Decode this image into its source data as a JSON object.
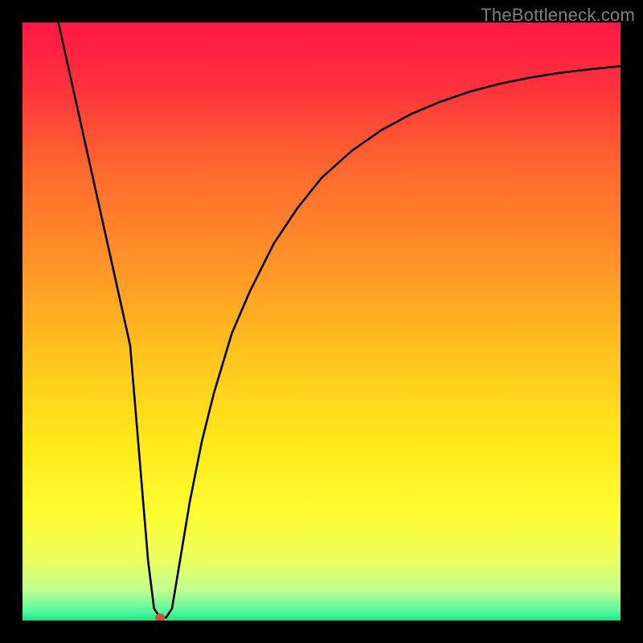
{
  "watermark": "TheBottleneck.com",
  "chart_data": {
    "type": "line",
    "title": "",
    "xlabel": "",
    "ylabel": "",
    "xlim": [
      0,
      100
    ],
    "ylim": [
      0,
      100
    ],
    "grid": false,
    "legend": false,
    "gradient_stops": [
      {
        "offset": 0.0,
        "color": "#ff1846"
      },
      {
        "offset": 0.1,
        "color": "#ff2f3d"
      },
      {
        "offset": 0.25,
        "color": "#ff6a2f"
      },
      {
        "offset": 0.4,
        "color": "#ff9227"
      },
      {
        "offset": 0.55,
        "color": "#ffc21e"
      },
      {
        "offset": 0.7,
        "color": "#ffe81a"
      },
      {
        "offset": 0.82,
        "color": "#fdfd30"
      },
      {
        "offset": 0.9,
        "color": "#ecff60"
      },
      {
        "offset": 0.95,
        "color": "#bfff90"
      },
      {
        "offset": 0.985,
        "color": "#55f7a0"
      },
      {
        "offset": 1.0,
        "color": "#18e884"
      }
    ],
    "marker": {
      "x": 23,
      "y": 0.5,
      "color": "#d44b3a",
      "rx": 6,
      "ry": 5
    },
    "series": [
      {
        "name": "curve",
        "color": "#000000",
        "x": [
          6,
          10,
          14,
          18,
          20,
          21,
          22,
          23,
          24,
          25,
          26,
          28,
          30,
          32,
          35,
          38,
          42,
          46,
          50,
          55,
          60,
          65,
          70,
          75,
          80,
          85,
          90,
          95,
          100
        ],
        "y": [
          100,
          82,
          64,
          46,
          22,
          10,
          2,
          0.5,
          0.5,
          2,
          8,
          20,
          30,
          38,
          48,
          55,
          63,
          69,
          74,
          78.5,
          82,
          84.7,
          86.8,
          88.5,
          89.8,
          90.8,
          91.6,
          92.2,
          92.7
        ]
      }
    ]
  }
}
